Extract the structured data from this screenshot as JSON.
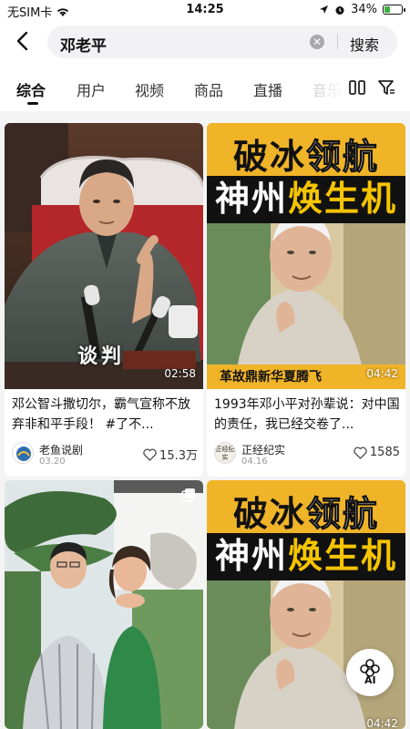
{
  "status_bar": {
    "carrier": "无SIM卡",
    "time": "14:25",
    "battery": "34%",
    "battery_level": 0.34
  },
  "search": {
    "query": "邓老平",
    "button_label": "搜索"
  },
  "tabs": [
    {
      "label": "综合",
      "active": true
    },
    {
      "label": "用户"
    },
    {
      "label": "视频"
    },
    {
      "label": "商品"
    },
    {
      "label": "直播"
    },
    {
      "label": "音乐"
    }
  ],
  "results": [
    {
      "overlay_text": "谈判",
      "duration": "02:58",
      "title": "邓公智斗撒切尔，霸气宣称不放弃非和平手段！ #了不...",
      "author": "老鱼说剧",
      "date": "03.20",
      "likes": "15.3万"
    },
    {
      "poster_line1": [
        "破冰",
        "领航"
      ],
      "poster_line2": [
        "神州",
        "焕生机"
      ],
      "caption": "革故鼎新华夏腾飞",
      "duration": "04:42",
      "title": "1993年邓小平对孙辈说：对中国的责任，我已经交卷了...",
      "author": "正经纪实",
      "avatar_text": "正经纪实",
      "date": "04.16",
      "likes": "1585"
    },
    {
      "overlay_text": ""
    },
    {
      "poster_line1": [
        "破冰",
        "领航"
      ],
      "poster_line2": [
        "神州",
        "焕生机"
      ],
      "duration": "04:42"
    }
  ],
  "colors": {
    "poster_bg": "#f0b429",
    "poster_black": "#111111",
    "poster_red": "#d62828",
    "poster_yellow": "#f5c400"
  },
  "ai_button": "AI"
}
